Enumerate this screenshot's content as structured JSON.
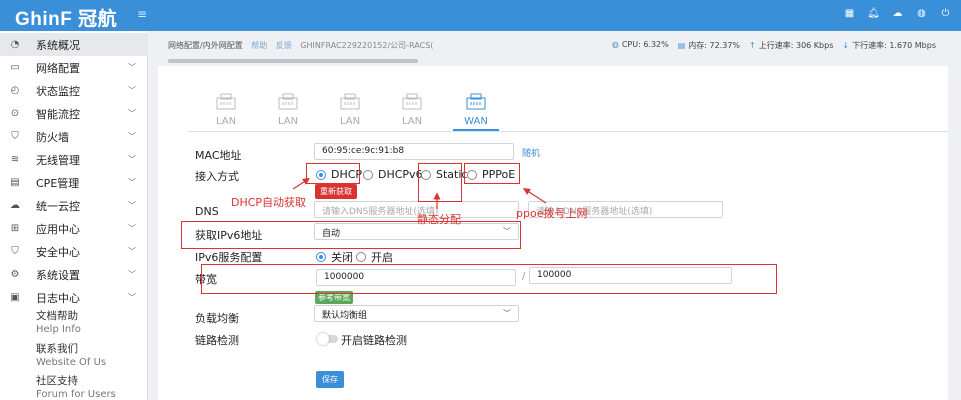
{
  "topbar": {
    "logo": "GhinF 冠航",
    "menu_toggle": "≡",
    "icons": [
      "grid-icon",
      "bell-icon",
      "cloud-icon",
      "globe-icon",
      "power-icon"
    ],
    "color": "#3a8fd9"
  },
  "sidebar": {
    "items": [
      {
        "label": "系统概况",
        "icon": "dashboard-icon",
        "active": true
      },
      {
        "label": "网络配置",
        "icon": "network-icon"
      },
      {
        "label": "状态监控",
        "icon": "monitor-icon"
      },
      {
        "label": "智能流控",
        "icon": "flow-icon"
      },
      {
        "label": "防火墙",
        "icon": "shield-icon"
      },
      {
        "label": "无线管理",
        "icon": "wifi-icon"
      },
      {
        "label": "CPE管理",
        "icon": "cpe-icon"
      },
      {
        "label": "统一云控",
        "icon": "cloud-icon"
      },
      {
        "label": "应用中心",
        "icon": "apps-icon"
      },
      {
        "label": "安全中心",
        "icon": "security-icon"
      },
      {
        "label": "系统设置",
        "icon": "gear-icon"
      },
      {
        "label": "日志中心",
        "icon": "log-icon"
      }
    ],
    "docs": [
      {
        "label": "文档帮助",
        "en": "Help Info"
      },
      {
        "label": "联系我们",
        "en": "Website Of Us"
      },
      {
        "label": "社区支持",
        "en": "Forum for Users"
      }
    ]
  },
  "header": {
    "breadcrumb": "网络配置/内外网配置",
    "help": "帮助",
    "feedback": "反馈",
    "device": "GHINFRAC229220152/公司-RACS(",
    "cpu": "CPU: 6.32%",
    "mem": "内存: 72.37%",
    "up": "上行速率: 306 Kbps",
    "down": "下行速率: 1.670 Mbps"
  },
  "tabs": [
    {
      "label": "LAN"
    },
    {
      "label": "LAN"
    },
    {
      "label": "LAN"
    },
    {
      "label": "LAN"
    },
    {
      "label": "WAN",
      "active": true
    }
  ],
  "form": {
    "mac_label": "MAC地址",
    "mac_value": "60:95:ce:9c:91:b8",
    "random": "随机",
    "access_label": "接入方式",
    "access_options": [
      "DHCP",
      "DHCPv6",
      "Static",
      "PPPoE"
    ],
    "access_selected": "DHCP",
    "renew": "重新获取",
    "dns_label": "DNS",
    "dns_placeholder": "请输入DNS服务器地址(选填)",
    "dns_placeholder2": "请输入DNS服务器地址(选填)",
    "ipv6_label": "获取IPv6地址",
    "ipv6_value": "自动",
    "ipv6srv_label": "IPv6服务配置",
    "ipv6srv_options": [
      "关闭",
      "开启"
    ],
    "ipv6srv_selected": "关闭",
    "bw_label": "带宽",
    "bw_up": "1000000",
    "bw_sep": "/",
    "bw_down": "100000",
    "bw_ref": "参考带宽",
    "lb_label": "负载均衡",
    "lb_value": "默认均衡组",
    "link_label": "链路检测",
    "link_toggle": "开启链路检测",
    "save": "保存"
  },
  "annotations": {
    "dhcp": "DHCP自动获取",
    "static": "静态分配",
    "pppoe": "ppoe拨号上网",
    "color": "#d9342f"
  }
}
